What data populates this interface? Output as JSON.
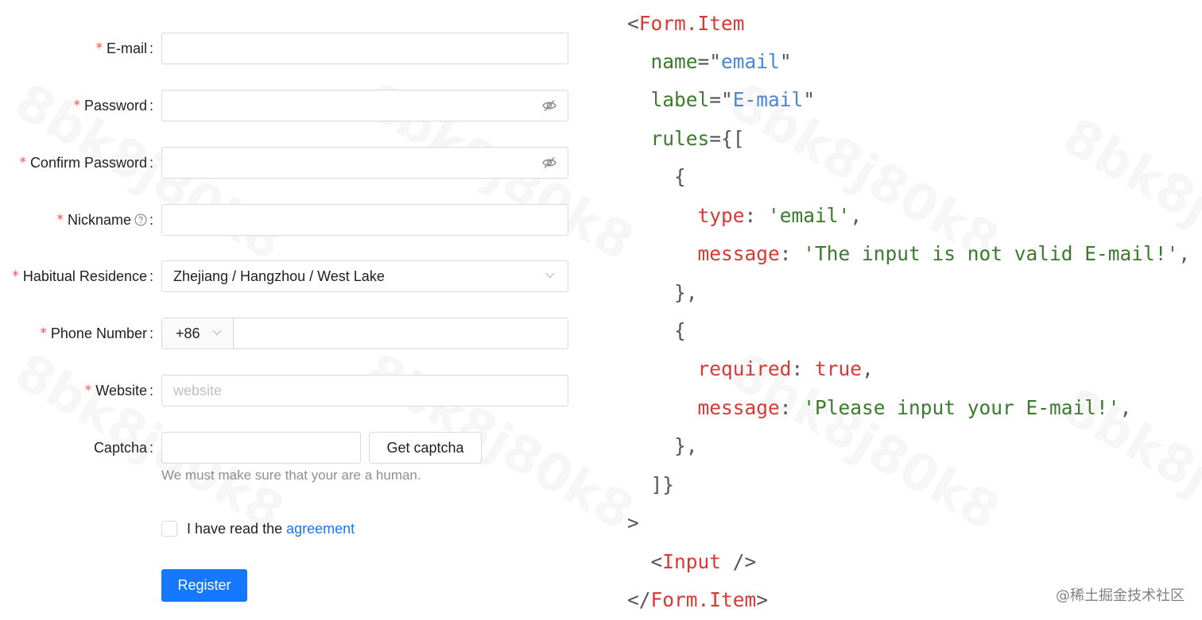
{
  "form": {
    "fields": [
      {
        "label": "E-mail",
        "required": true,
        "type": "text",
        "value": ""
      },
      {
        "label": "Password",
        "required": true,
        "type": "password",
        "value": ""
      },
      {
        "label": "Confirm Password",
        "required": true,
        "type": "password",
        "value": ""
      },
      {
        "label": "Nickname",
        "required": true,
        "type": "text",
        "value": ""
      },
      {
        "label": "Habitual Residence",
        "required": true,
        "type": "cascader",
        "value": "Zhejiang / Hangzhou / West Lake"
      },
      {
        "label": "Phone Number",
        "required": true,
        "type": "phone",
        "prefix": "+86",
        "value": ""
      },
      {
        "label": "Website",
        "required": true,
        "type": "text",
        "placeholder": "website",
        "value": ""
      },
      {
        "label": "Captcha",
        "required": false,
        "type": "captcha",
        "value": ""
      }
    ],
    "captcha_button": "Get captcha",
    "captcha_extra": "We must make sure that your are a human.",
    "agreement_text": "I have read the",
    "agreement_link": "agreement",
    "register_label": "Register",
    "colon": ":",
    "required_mark": "*"
  },
  "code": {
    "open_tag": "Form.Item",
    "name_attr": "name",
    "name_value": "email",
    "label_attr": "label",
    "label_value": "E-mail",
    "rules_attr": "rules",
    "rule1_type_key": "type",
    "rule1_type_value": "'email'",
    "rule1_msg_key": "message",
    "rule1_msg_value": "'The input is not valid E-mail!'",
    "rule2_req_key": "required",
    "rule2_req_value": "true",
    "rule2_msg_key": "message",
    "rule2_msg_value": "'Please input your E-mail!'",
    "input_tag": "Input",
    "close_tag": "Form.Item"
  },
  "watermark": "@稀土掘金技术社区",
  "colors": {
    "primary": "#1677ff",
    "required": "#ff4d4f",
    "code_red": "#d73a34",
    "code_green": "#3b7a2f",
    "code_blue": "#4a86d1"
  }
}
